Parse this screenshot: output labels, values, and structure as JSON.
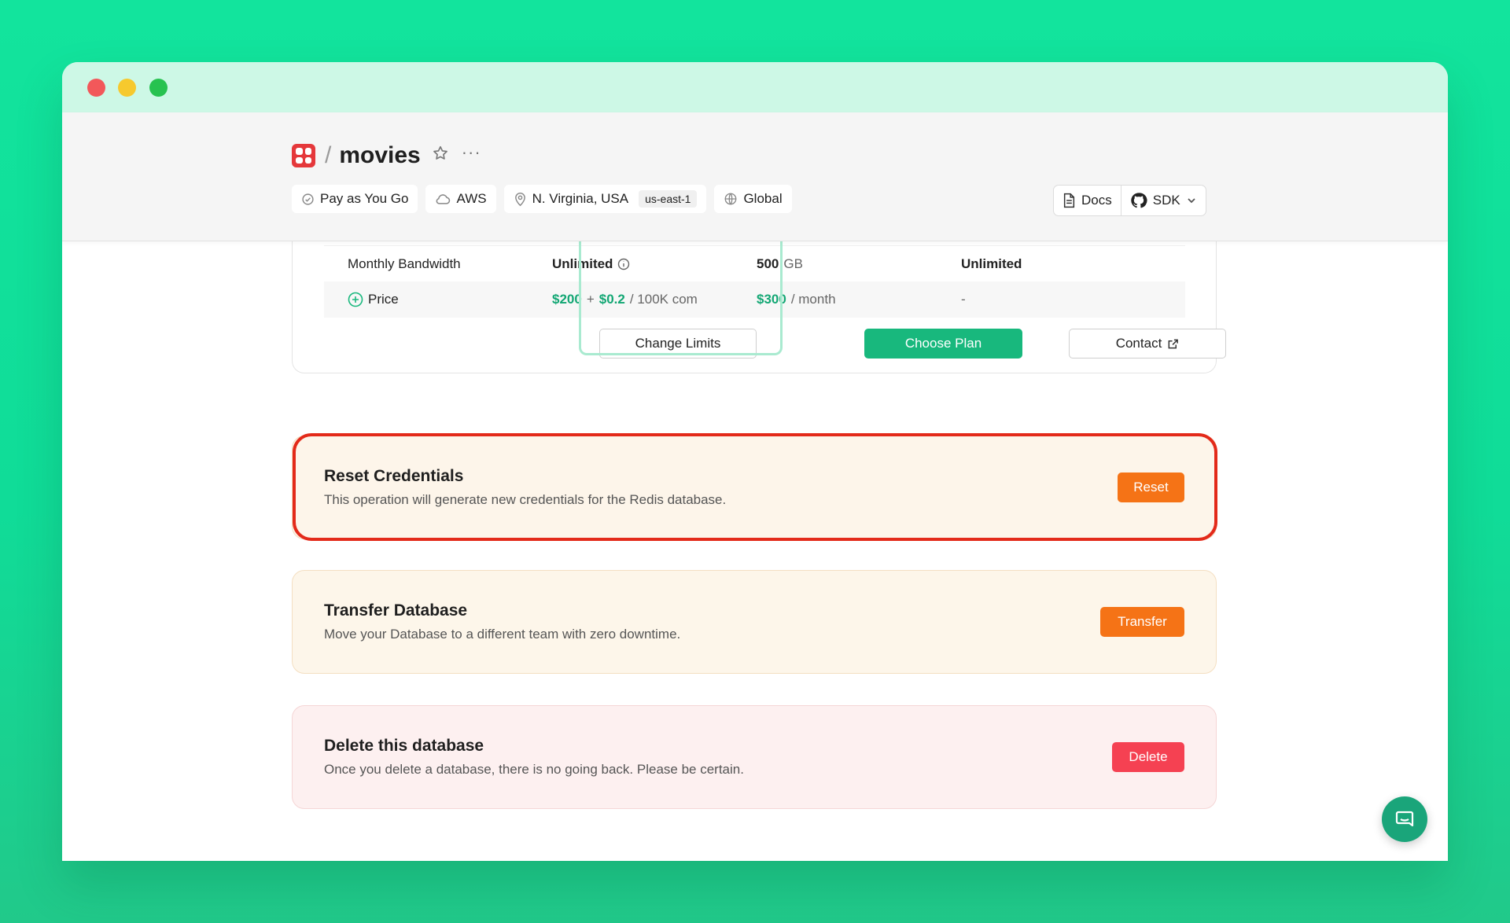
{
  "window": {
    "controls": [
      "close",
      "minimize",
      "maximize"
    ]
  },
  "header": {
    "separator": "/",
    "db_name": "movies",
    "more": "···",
    "chips": {
      "plan": "Pay as You Go",
      "cloud": "AWS",
      "region": "N. Virginia, USA",
      "region_code": "us-east-1",
      "scope": "Global"
    },
    "docs_label": "Docs",
    "sdk_label": "SDK"
  },
  "pricing": {
    "bandwidth_label": "Monthly Bandwidth",
    "bandwidth_payg": "Unlimited",
    "bandwidth_fixed_value": "500",
    "bandwidth_fixed_unit": "GB",
    "bandwidth_enterprise": "Unlimited",
    "price_label": "Price",
    "payg_price_a": "$200",
    "payg_plus": "+",
    "payg_price_b": "$0.2",
    "payg_price_unit": "/ 100K com",
    "fixed_price": "$300",
    "fixed_price_unit": "/ month",
    "enterprise_price": "-",
    "change_limits_label": "Change Limits",
    "choose_plan_label": "Choose Plan",
    "contact_label": "Contact"
  },
  "reset": {
    "title": "Reset Credentials",
    "description": "This operation will generate new credentials for the Redis database.",
    "button": "Reset"
  },
  "transfer": {
    "title": "Transfer Database",
    "description": "Move your Database to a different team with zero downtime.",
    "button": "Transfer"
  },
  "delete": {
    "title": "Delete this database",
    "description": "Once you delete a database, there is no going back. Please be certain.",
    "button": "Delete"
  },
  "colors": {
    "accent_green": "#18b87d",
    "warning_orange": "#f57316",
    "danger_red": "#f54152",
    "highlight_outline": "#e32a1a"
  }
}
